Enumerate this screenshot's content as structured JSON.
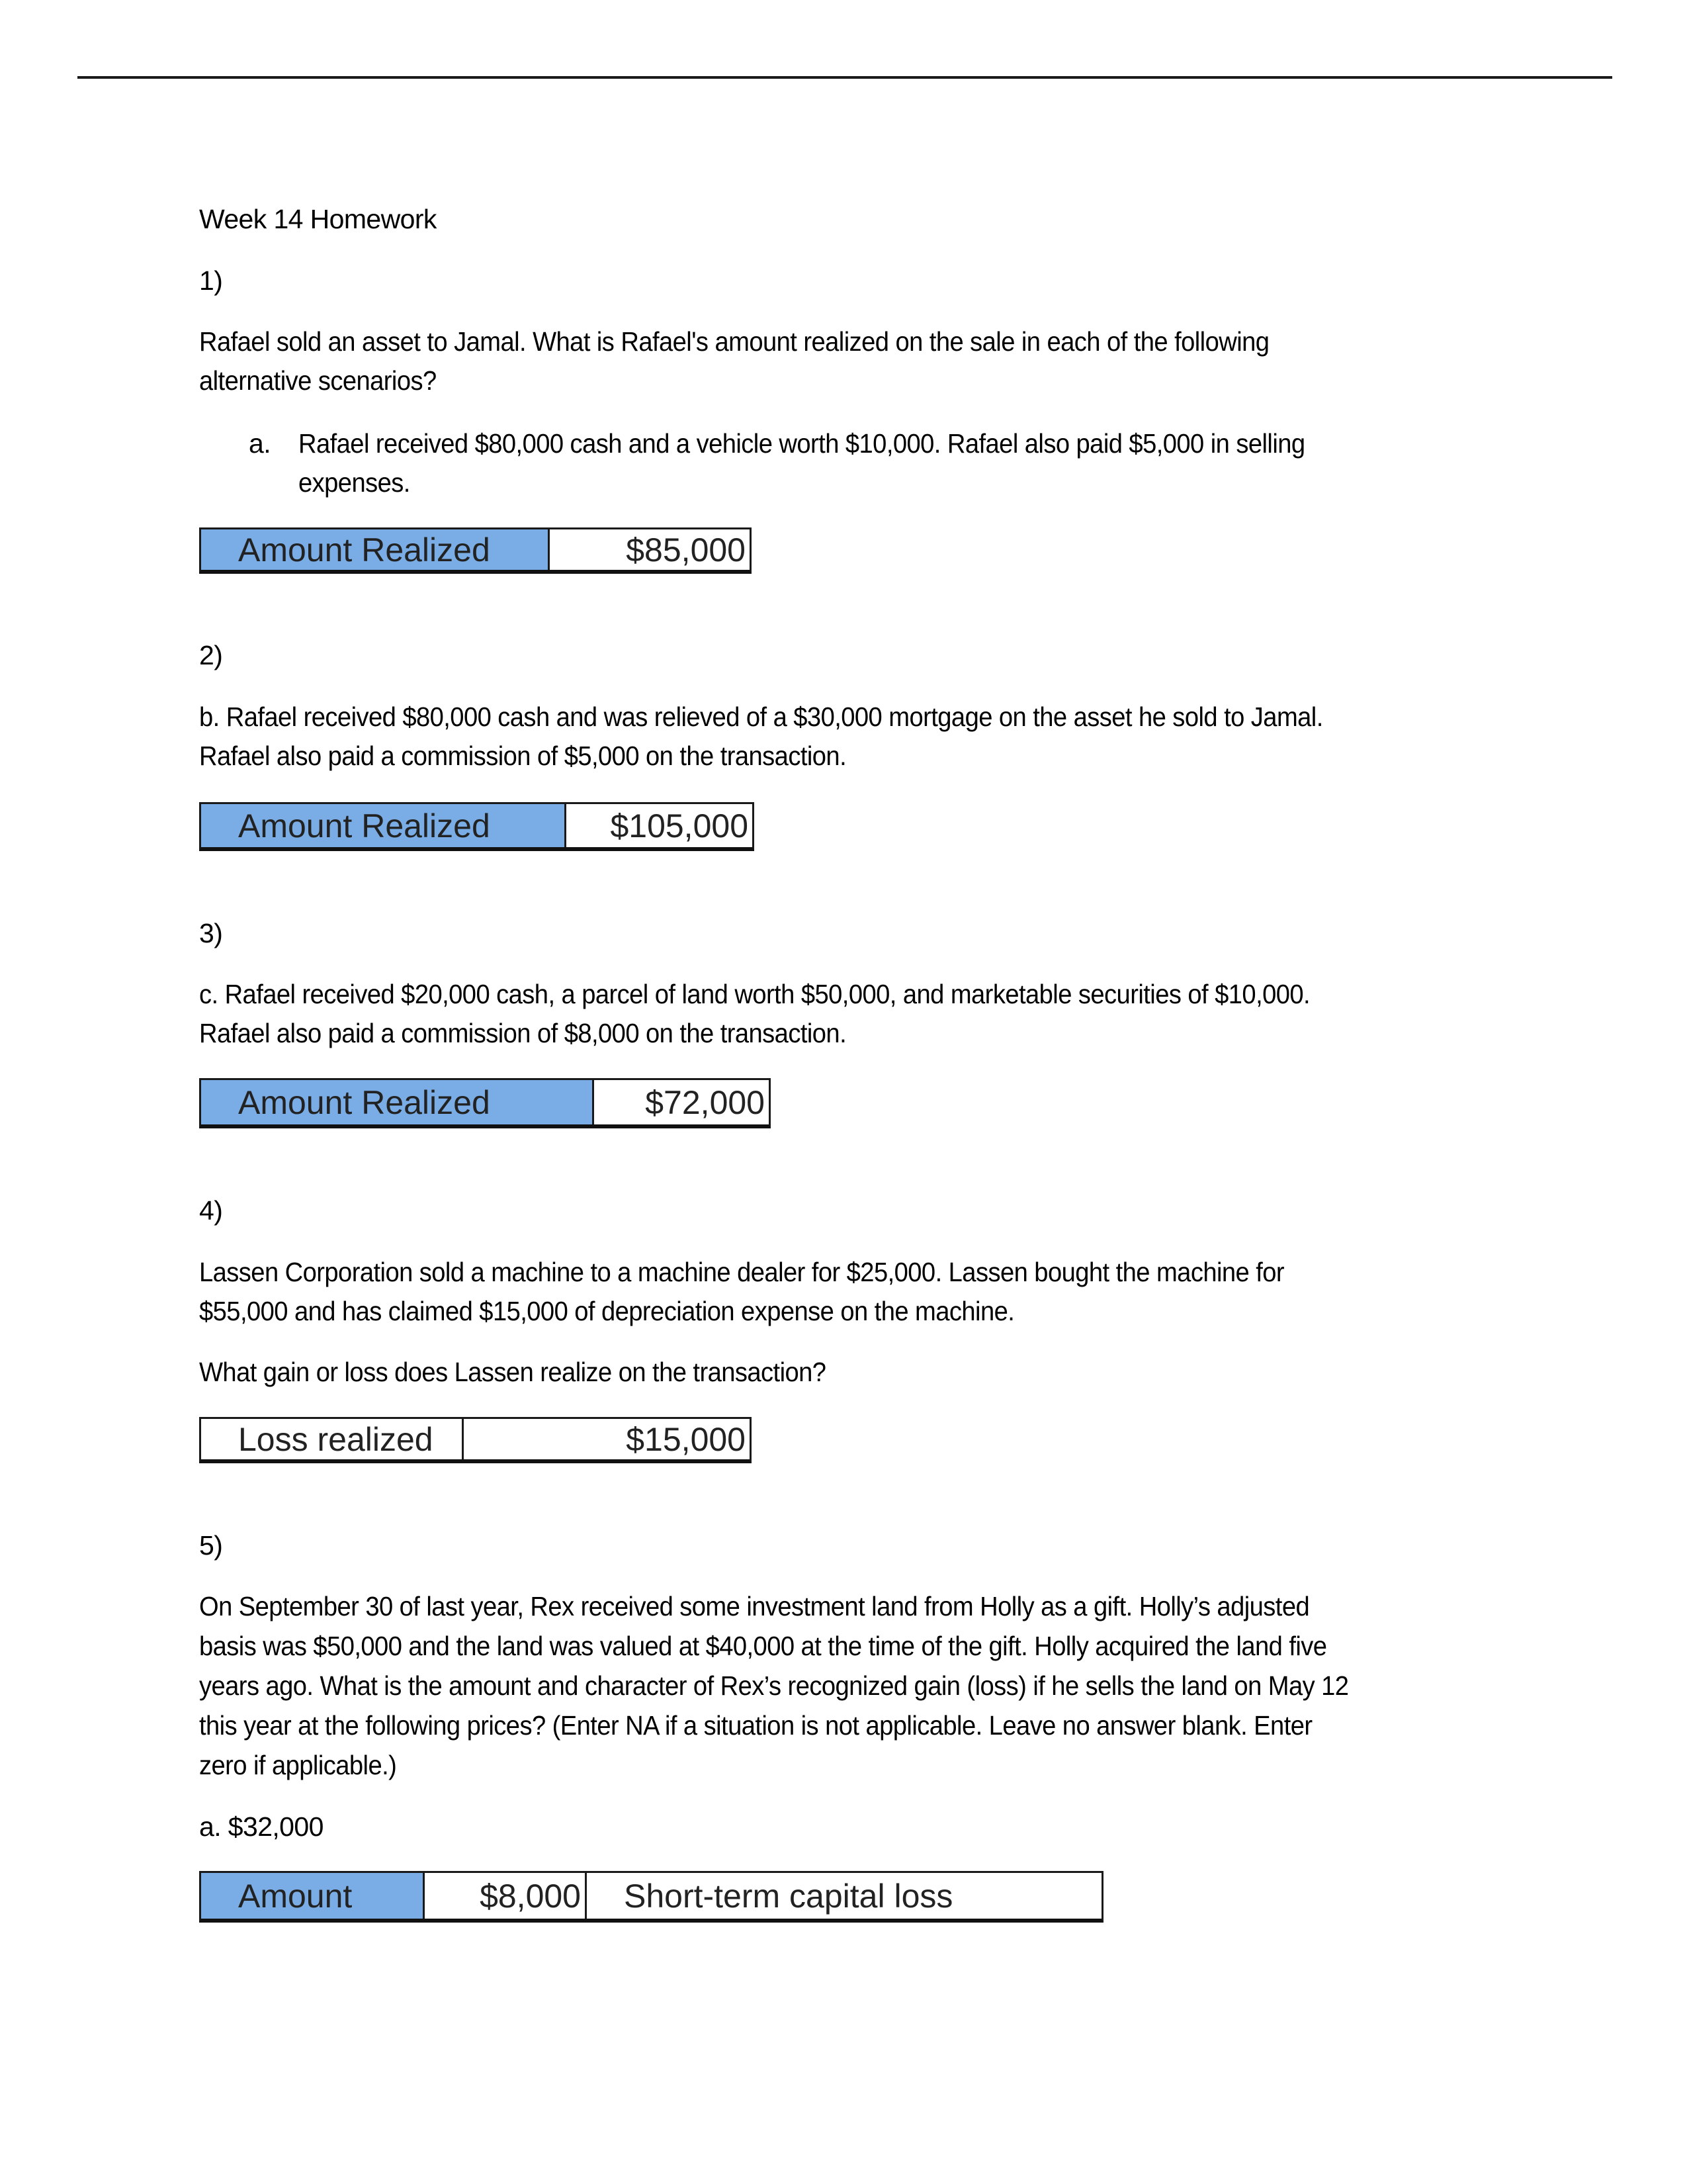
{
  "document": {
    "title": "Week 14 Homework",
    "questions": [
      {
        "number": "1)",
        "intro_lines": [
          "Rafael sold an asset to Jamal. What is Rafael's amount realized on the sale in each of the following",
          "alternative scenarios?"
        ],
        "item_label": "a.",
        "item_lines": [
          "Rafael received $80,000 cash and a vehicle worth $10,000. Rafael also paid $5,000 in selling",
          "expenses."
        ],
        "answer": {
          "label": "Amount Realized",
          "value": "$85,000",
          "label_bg": "#7aade5"
        }
      },
      {
        "number": "2)",
        "text_lines": [
          "b. Rafael received $80,000 cash and was relieved of a $30,000 mortgage on the asset he sold to Jamal.",
          "Rafael also paid a commission of $5,000 on the transaction."
        ],
        "answer": {
          "label": "Amount Realized",
          "value": "$105,000",
          "label_bg": "#7aade5"
        }
      },
      {
        "number": "3)",
        "text_lines": [
          "c. Rafael received $20,000 cash, a parcel of land worth $50,000, and marketable securities of $10,000.",
          "Rafael also paid a commission of $8,000 on the transaction."
        ],
        "answer": {
          "label": "Amount Realized",
          "value": "$72,000",
          "label_bg": "#7aade5"
        }
      },
      {
        "number": "4)",
        "text_lines": [
          "Lassen Corporation sold a machine to a machine dealer for $25,000. Lassen bought the machine for",
          "$55,000 and has claimed $15,000 of depreciation expense on the machine."
        ],
        "question": "What gain or loss does Lassen realize on the transaction?",
        "answer": {
          "label": "Loss realized",
          "value": "$15,000",
          "label_bg": "#ffffff"
        }
      },
      {
        "number": "5)",
        "text_lines": [
          "On September 30 of last year, Rex received some investment land from Holly as a gift. Holly’s adjusted",
          "basis was $50,000 and the land was valued at $40,000 at the time of the gift. Holly acquired the land five",
          "years ago. What is the amount and character of Rex’s recognized gain (loss) if he sells the land on May 12",
          "this year at the following prices? (Enter NA if a situation is not applicable. Leave no answer blank. Enter",
          "zero if applicable.)"
        ],
        "part": "a. $32,000",
        "answer": {
          "label": "Amount",
          "value": "$8,000",
          "character": "Short-term capital loss",
          "label_bg": "#7aade5"
        }
      }
    ]
  }
}
